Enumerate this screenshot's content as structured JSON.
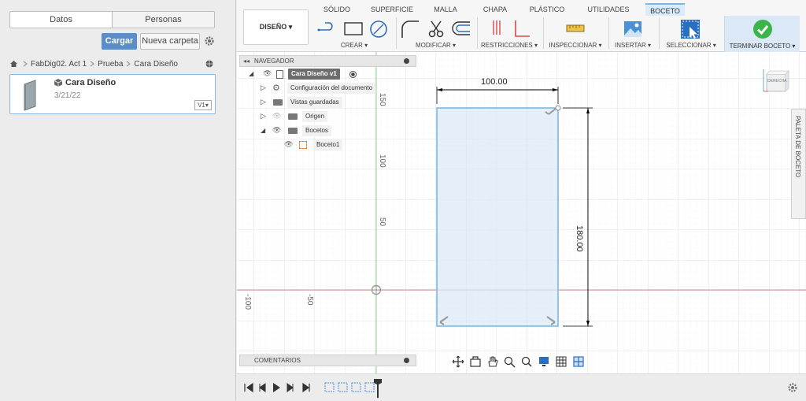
{
  "data_panel": {
    "tabs": [
      "Datos",
      "Personas"
    ],
    "upload_label": "Cargar",
    "new_folder_label": "Nueva carpeta",
    "breadcrumb": [
      "FabDig02. Act 1",
      "Prueba",
      "Cara Diseño"
    ],
    "file": {
      "name": "Cara Diseño",
      "date": "3/21/22",
      "version": "V1"
    }
  },
  "toolbar": {
    "tabs": [
      "SÓLIDO",
      "SUPERFICIE",
      "MALLA",
      "CHAPA",
      "PLÁSTICO",
      "UTILIDADES",
      "BOCETO"
    ],
    "active_tab": "BOCETO",
    "workspace_label": "DISEÑO ▾",
    "groups": {
      "create": "CREAR ▾",
      "modify": "MODIFICAR ▾",
      "constraints": "RESTRICCIONES ▾",
      "inspect": "INSPECCIONAR ▾",
      "insert": "INSERTAR ▾",
      "select": "SELECCIONAR ▾",
      "finish": "TERMINAR BOCETO ▾"
    }
  },
  "navigator": {
    "title": "NAVEGADOR",
    "root": "Cara Diseño v1",
    "items": [
      "Configuración del documento",
      "Vistas guardadas",
      "Origen",
      "Bocetos",
      "Boceto1"
    ]
  },
  "comments_label": "COMENTARIOS",
  "sketch": {
    "width_dim": "100.00",
    "height_dim": "180.00",
    "axis_labels_v": [
      "150",
      "100",
      "50"
    ],
    "axis_labels_h": [
      "-100",
      "-50"
    ]
  },
  "viewcube_label": "DERECHA",
  "palette_label": "PALETA DE BOCETO",
  "colors": {
    "accent": "#5b8ec9",
    "sketch_fill": "#dceaf7",
    "sketch_line": "#7fb7e0",
    "axis_red": "#e28a8a",
    "axis_green": "#8fd18f"
  }
}
